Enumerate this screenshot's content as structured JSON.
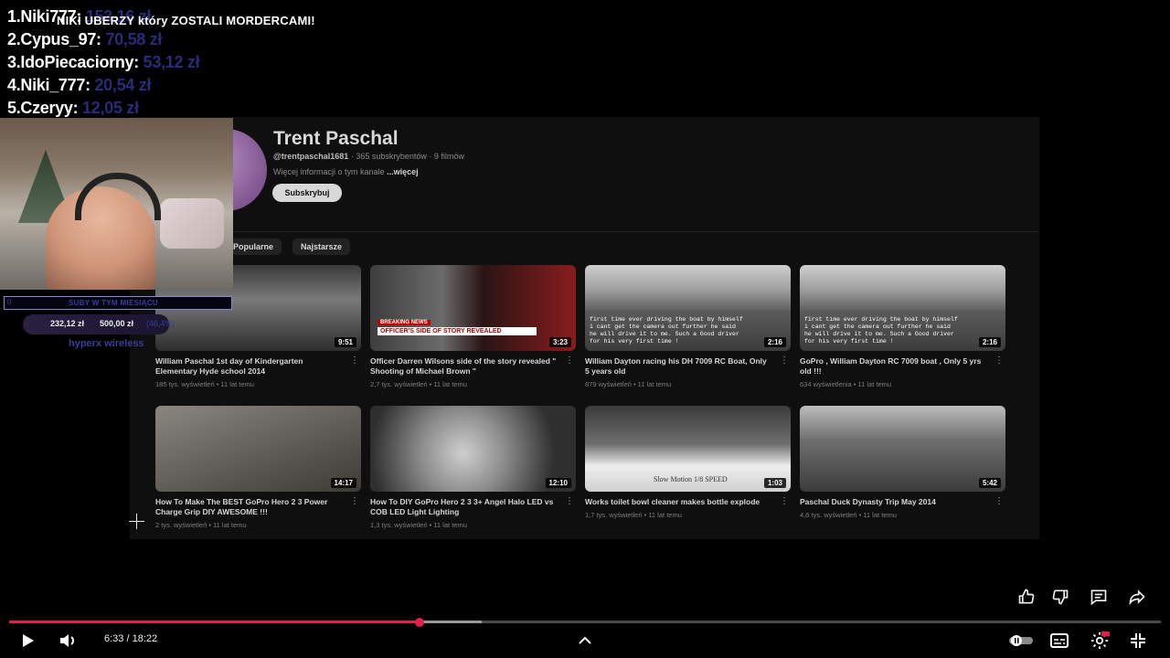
{
  "stream": {
    "alert_text": "NIKI UBERZY który ZOSTALI MORDERCAMI!",
    "donors": [
      {
        "rank_name": "1.Niki777:",
        "amount": "153,16 zł"
      },
      {
        "rank_name": "2.Cypus_97:",
        "amount": "70,58 zł"
      },
      {
        "rank_name": "3.IdoPiecaciorny:",
        "amount": "53,12 zł"
      },
      {
        "rank_name": "4.Niki_777:",
        "amount": "20,54 zł"
      },
      {
        "rank_name": "5.Czeryy:",
        "amount": "12,05 zł"
      }
    ],
    "sub_goal": {
      "label": "SUBY W TYM MIESIĄCU",
      "zero": "0"
    },
    "donation_goal": {
      "current": "232,12 zł",
      "target": "500,00 zł",
      "percent": "(46,4%)",
      "progress": 0.464
    },
    "sponsor": "hyperx wireless"
  },
  "channel": {
    "name": "Trent Paschal",
    "handle": "@trentpaschal1681",
    "stats": " · 365 subskrybentów · 9 filmów",
    "more_info": "Więcej informacji o tym kanale",
    "more_link": "...więcej",
    "subscribe_label": "Subskrybuj",
    "chips": [
      "Popularne",
      "Najstarsze"
    ],
    "videos": [
      {
        "title": "William Paschal 1st day of Kindergarten Elementary Hyde school 2014",
        "meta": "185 tys. wyświetleń • 11 lat temu",
        "duration": "9:51"
      },
      {
        "title": "Officer Darren Wilsons side of the story revealed \" Shooting of Michael Brown \"",
        "meta": "2,7 tys. wyświetleń • 11 lat temu",
        "duration": "3:23",
        "banner": "OFFICER'S SIDE OF STORY REVEALED",
        "tag": "BREAKING NEWS"
      },
      {
        "title": "William Dayton racing his DH 7009 RC Boat, Only 5 years old",
        "meta": "879 wyświetleń • 11 lat temu",
        "duration": "2:16",
        "caption": "first time ever driving the boat by himself i cant get the camera out further he said he will drive it to me. Such a Good driver for his very first time !"
      },
      {
        "title": "GoPro , William Dayton RC 7009 boat , Only 5 yrs old !!!",
        "meta": "634 wyświetlenia • 11 lat temu",
        "duration": "2:16",
        "caption": "first time ever driving the boat by himself i cant get the camera out further he said he will drive it to me. Such a Good driver for his very first time !"
      },
      {
        "title": "How To Make The BEST GoPro Hero 2 3 Power Charge Grip DIY AWESOME !!!",
        "meta": "2 tys. wyświetleń • 11 lat temu",
        "duration": "14:17"
      },
      {
        "title": "How To DIY GoPro Hero 2 3 3+ Angel Halo LED vs COB LED Light Lighting",
        "meta": "1,3 tys. wyświetleń • 11 lat temu",
        "duration": "12:10"
      },
      {
        "title": "Works toilet bowl cleaner makes bottle explode",
        "meta": "1,7 tys. wyświetleń • 11 lat temu",
        "duration": "1:03",
        "caption": "Slow Motion 1/8 SPEED"
      },
      {
        "title": "Paschal Duck Dynasty Trip May 2014",
        "meta": "4,6 tys. wyświetleń • 11 lat temu",
        "duration": "5:42"
      }
    ]
  },
  "player": {
    "time": "6:33 / 18:22",
    "progress": 0.3566,
    "buffered": 0.41
  },
  "colors": {
    "accent": "#e0224a",
    "donor_amount": "#2b2a7a"
  }
}
